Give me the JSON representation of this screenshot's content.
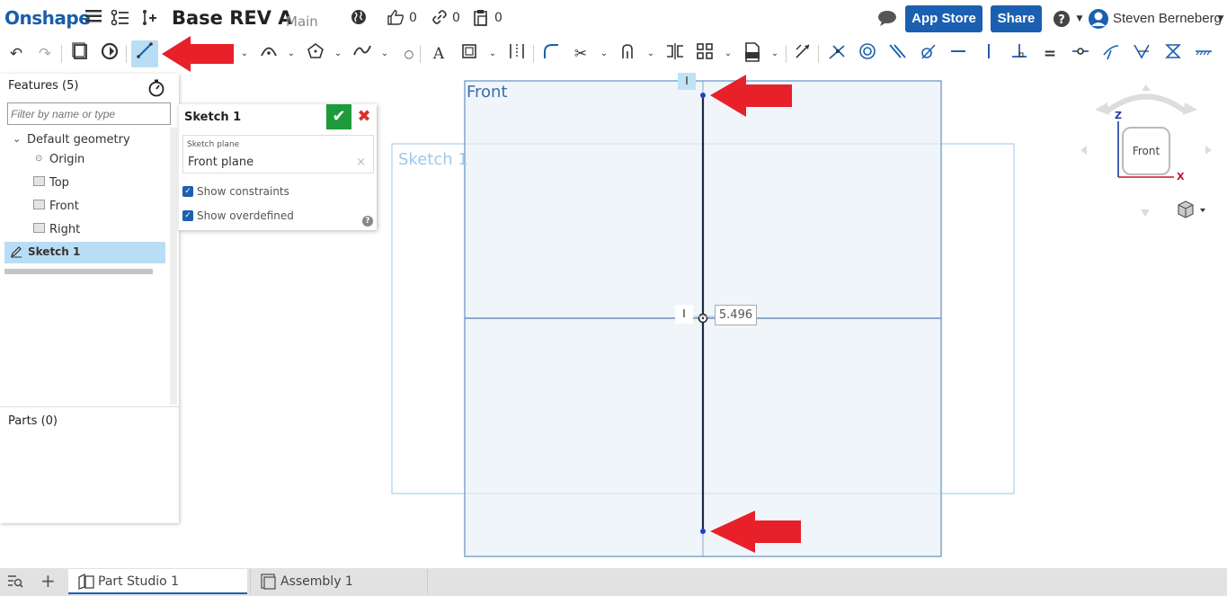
{
  "header": {
    "logo": "Onshape",
    "doc_title": "Base REV A",
    "branch": "Main",
    "likes": "0",
    "links": "0",
    "copies": "0",
    "app_store_label": "App Store",
    "share_label": "Share",
    "user_name": "Steven Berneberg",
    "help_glyph": "?",
    "icons": [
      "menu-icon",
      "versions-icon",
      "insert-icon",
      "globe-icon",
      "thumbs-up-icon",
      "link-icon",
      "clipboard-icon",
      "chat-icon",
      "help-icon",
      "user-avatar-icon"
    ]
  },
  "toolbar": {
    "icons": [
      "undo-icon",
      "redo-icon",
      "sketch-icon",
      "sketch-select-icon",
      "line-icon",
      "arc-icon",
      "polygon-icon",
      "spline-icon",
      "point-icon",
      "text-icon",
      "offset-icon",
      "construction-icon",
      "fillet-icon",
      "trim-icon",
      "extend-icon",
      "mirror-icon",
      "pattern-icon",
      "dxf-import-icon",
      "dimension-icon",
      "coincident-icon",
      "concentric-icon",
      "parallel-icon",
      "tangent-icon",
      "horizontal-icon",
      "vertical-icon",
      "perpendicular-icon",
      "equal-icon",
      "midpoint-icon",
      "normal-icon",
      "pierce-icon",
      "symmetric-icon",
      "fix-icon"
    ],
    "selected_tool": "line-icon"
  },
  "feature_panel": {
    "title": "Features (5)",
    "filter_placeholder": "Filter by name or type",
    "tree": {
      "group": "Default geometry",
      "items": [
        {
          "label": "Origin",
          "icon": "origin-icon"
        },
        {
          "label": "Top",
          "icon": "plane-icon"
        },
        {
          "label": "Front",
          "icon": "plane-icon"
        },
        {
          "label": "Right",
          "icon": "plane-icon"
        }
      ],
      "selected": {
        "label": "Sketch 1",
        "icon": "sketch-pencil-icon"
      }
    },
    "parts_title": "Parts (0)"
  },
  "sketch_dialog": {
    "title": "Sketch 1",
    "plane_label": "Sketch plane",
    "plane_value": "Front plane",
    "show_constraints": "Show constraints",
    "show_overdefined": "Show overdefined",
    "show_constraints_checked": true,
    "show_overdefined_checked": true
  },
  "canvas": {
    "front_label": "Front",
    "sketch_label": "Sketch 1",
    "dimension_value": "5.496",
    "vertical_constraint_glyph": "I"
  },
  "view_cube": {
    "face": "Front",
    "axis_z": "Z",
    "axis_x": "X",
    "axis_z_color": "#1b3aa0",
    "axis_x_color": "#c8102e"
  },
  "bottom_tabs": [
    {
      "label": "Part Studio 1",
      "icon": "part-studio-icon",
      "active": true
    },
    {
      "label": "Assembly 1",
      "icon": "assembly-icon",
      "active": false
    }
  ],
  "colors": {
    "brand_blue": "#1b5fb0",
    "accept_green": "#1f9a3b",
    "cancel_red": "#d9322c",
    "annotation_arrow_red": "#e8202a",
    "selection_blue": "#b9ddf5"
  }
}
